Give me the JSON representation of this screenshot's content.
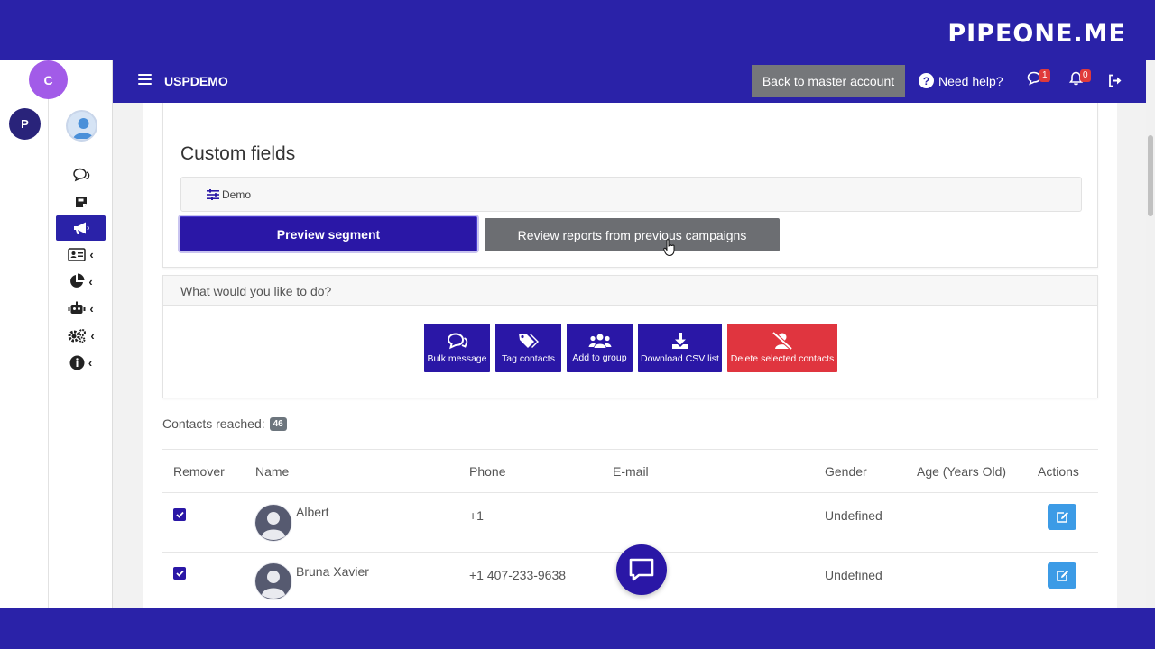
{
  "brand": "PIPEONE.ME",
  "rail": {
    "account_initial": "P"
  },
  "sidebar": {
    "account_initial": "C",
    "items": [
      {
        "icon": "chat-icon",
        "active": false
      },
      {
        "icon": "note-icon",
        "active": false
      },
      {
        "icon": "megaphone-icon",
        "active": true
      },
      {
        "icon": "contact-card-icon",
        "active": false,
        "expandable": true
      },
      {
        "icon": "pie-chart-icon",
        "active": false,
        "expandable": true
      },
      {
        "icon": "robot-icon",
        "active": false,
        "expandable": true
      },
      {
        "icon": "gears-icon",
        "active": false,
        "expandable": true
      },
      {
        "icon": "info-icon",
        "active": false,
        "expandable": true
      }
    ],
    "chevron": "‹"
  },
  "navbar": {
    "account_name": "USPDEMO",
    "back_label": "Back to master account",
    "help_label": "Need help?",
    "messages_count": "1",
    "notifications_count": "0"
  },
  "custom_fields": {
    "title": "Custom fields",
    "filter_label": "Demo"
  },
  "buttons": {
    "preview": "Preview segment",
    "review": "Review reports from previous campaigns"
  },
  "actions": {
    "header": "What would you like to do?",
    "items": [
      {
        "label": "Bulk message",
        "icon": "chat-icon"
      },
      {
        "label": "Tag contacts",
        "icon": "tags-icon"
      },
      {
        "label": "Add to group",
        "icon": "users-icon"
      },
      {
        "label": "Download CSV list",
        "icon": "download-icon"
      },
      {
        "label": "Delete selected contacts",
        "icon": "user-slash-icon"
      }
    ]
  },
  "reached": {
    "label": "Contacts reached:",
    "count": "46"
  },
  "table": {
    "columns": [
      "Remover",
      "Name",
      "Phone",
      "E-mail",
      "Gender",
      "Age (Years Old)",
      "Actions"
    ],
    "rows": [
      {
        "checked": true,
        "name": "Albert",
        "phone": "+1",
        "email": "",
        "gender": "Undefined",
        "age": ""
      },
      {
        "checked": true,
        "name": "Bruna Xavier",
        "phone": "+1 407-233-9638",
        "email": "",
        "gender": "Undefined",
        "age": ""
      }
    ]
  },
  "colors": {
    "primary": "#2a17a6",
    "band": "#2a22a8",
    "danger": "#e0353f",
    "secondary": "#6c6e72",
    "edit": "#3c9be6"
  }
}
